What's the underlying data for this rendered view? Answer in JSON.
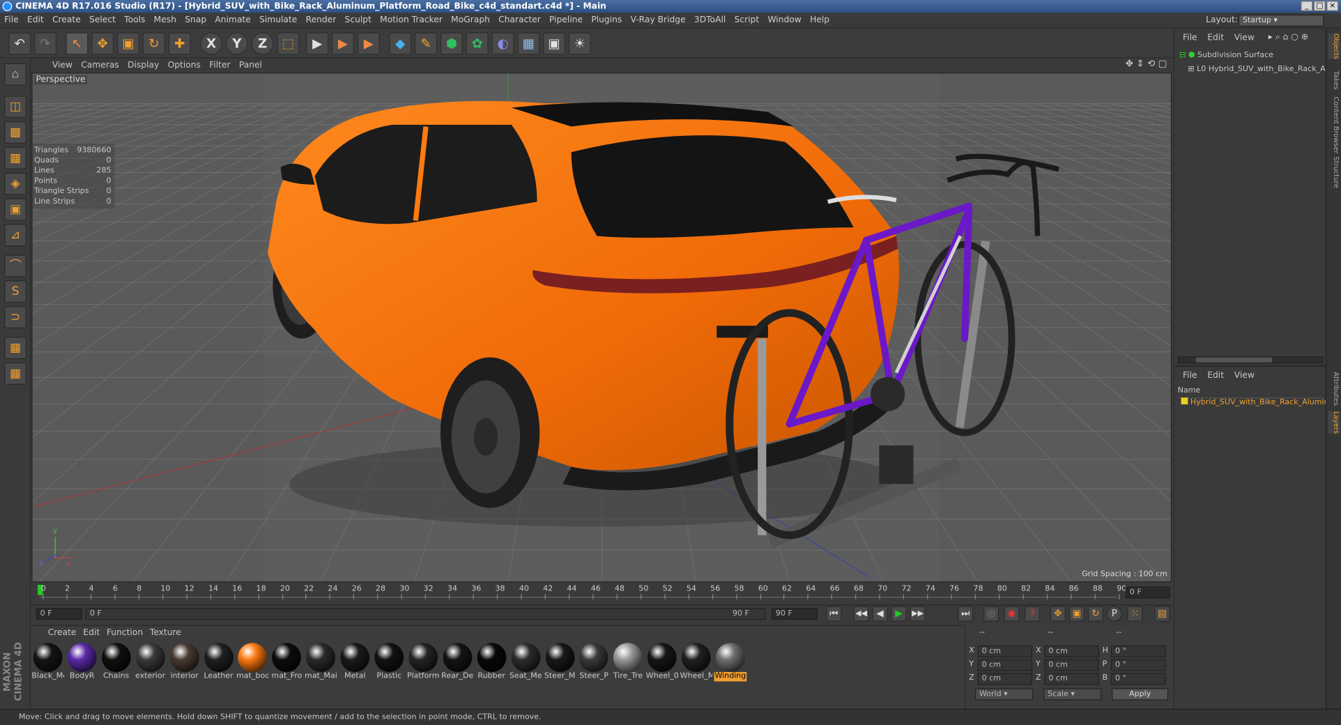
{
  "window": {
    "title": "CINEMA 4D R17.016 Studio (R17) - [Hybrid_SUV_with_Bike_Rack_Aluminum_Platform_Road_Bike_c4d_standart.c4d *] - Main",
    "min": "_",
    "max": "□",
    "close": "×"
  },
  "menu": [
    "File",
    "Edit",
    "Create",
    "Select",
    "Tools",
    "Mesh",
    "Snap",
    "Animate",
    "Simulate",
    "Render",
    "Sculpt",
    "Motion Tracker",
    "MoGraph",
    "Character",
    "Pipeline",
    "Plugins",
    "V-Ray Bridge",
    "3DToAll",
    "Script",
    "Window",
    "Help"
  ],
  "layout": {
    "label": "Layout:",
    "value": "Startup"
  },
  "toolbar": {
    "undo": "↶",
    "redo": "↷",
    "select": "↖",
    "move": "✥",
    "scale": "▣",
    "rotate": "↻",
    "add": "✚",
    "x": "X",
    "y": "Y",
    "z": "Z",
    "coord": "⬚",
    "render1": "▶",
    "render2": "▶",
    "render3": "▶",
    "cube": "◆",
    "pen": "✎",
    "subdiv": "⬢",
    "gen": "✿",
    "deform": "◐",
    "floor": "▦",
    "camera": "▣",
    "light": "☀"
  },
  "left_tools": [
    "⌂",
    "◫",
    "▩",
    "▦",
    "◈",
    "▣",
    "⊿",
    "⌒",
    "S",
    "⊃",
    "▦",
    "▦"
  ],
  "viewport": {
    "menu": [
      "View",
      "Cameras",
      "Display",
      "Options",
      "Filter",
      "Panel"
    ],
    "label": "Perspective",
    "stats": [
      {
        "k": "Triangles",
        "v": "9380660"
      },
      {
        "k": "Quads",
        "v": "0"
      },
      {
        "k": "Lines",
        "v": "285"
      },
      {
        "k": "Points",
        "v": "0"
      },
      {
        "k": "Triangle Strips",
        "v": "0"
      },
      {
        "k": "Line Strips",
        "v": "0"
      }
    ],
    "grid_spacing": "Grid Spacing : 100 cm",
    "axis": {
      "x": "x",
      "y": "y",
      "z": "z"
    }
  },
  "timeline": {
    "ticks": [
      "0",
      "2",
      "4",
      "6",
      "8",
      "10",
      "12",
      "14",
      "16",
      "18",
      "20",
      "22",
      "24",
      "26",
      "28",
      "30",
      "32",
      "34",
      "36",
      "38",
      "40",
      "42",
      "44",
      "46",
      "48",
      "50",
      "52",
      "54",
      "56",
      "58",
      "60",
      "62",
      "64",
      "66",
      "68",
      "70",
      "72",
      "74",
      "76",
      "78",
      "80",
      "82",
      "84",
      "86",
      "88",
      "90"
    ],
    "frame_field": "0 F"
  },
  "controls": {
    "start": "0 F",
    "range_start": "0 F",
    "range_end": "90 F",
    "end": "90 F",
    "buttons": [
      "⏮",
      "◀◀",
      "◀",
      "▶",
      "▶▶",
      "⏭"
    ]
  },
  "materials": {
    "menu": [
      "Create",
      "Edit",
      "Function",
      "Texture"
    ],
    "items": [
      {
        "name": "Black_Me",
        "color": "#151515"
      },
      {
        "name": "BodyR",
        "color": "#5a2aa8"
      },
      {
        "name": "Chains",
        "color": "#101010"
      },
      {
        "name": "exterior",
        "color": "#3a3a3a"
      },
      {
        "name": "interior",
        "color": "#4a3a32"
      },
      {
        "name": "Leather",
        "color": "#202020"
      },
      {
        "name": "mat_bod",
        "color": "#ff7a10"
      },
      {
        "name": "mat_Fro",
        "color": "#0c0c0c"
      },
      {
        "name": "mat_Mai",
        "color": "#2a2a2a"
      },
      {
        "name": "Metal",
        "color": "#1a1a1a"
      },
      {
        "name": "Plastic",
        "color": "#121212"
      },
      {
        "name": "Platform",
        "color": "#242424"
      },
      {
        "name": "Rear_De",
        "color": "#141414"
      },
      {
        "name": "Rubber",
        "color": "#080808"
      },
      {
        "name": "Seat_Me",
        "color": "#2c2c2c"
      },
      {
        "name": "Steer_M",
        "color": "#181818"
      },
      {
        "name": "Steer_P",
        "color": "#3a3a3a"
      },
      {
        "name": "Tire_Tre",
        "color": "#9a9a9a"
      },
      {
        "name": "Wheel_0",
        "color": "#161616"
      },
      {
        "name": "Wheel_M",
        "color": "#202020"
      },
      {
        "name": "Winding",
        "color": "#707070"
      }
    ],
    "selected": "Winding"
  },
  "attributes": {
    "header": [
      "--",
      "--",
      "--"
    ],
    "rows": [
      {
        "a": "X",
        "av": "0 cm",
        "b": "X",
        "bv": "0 cm",
        "c": "H",
        "cv": "0 °"
      },
      {
        "a": "Y",
        "av": "0 cm",
        "b": "Y",
        "bv": "0 cm",
        "c": "P",
        "cv": "0 °"
      },
      {
        "a": "Z",
        "av": "0 cm",
        "b": "Z",
        "bv": "0 cm",
        "c": "B",
        "cv": "0 °"
      }
    ],
    "world": "World",
    "scale": "Scale",
    "apply": "Apply"
  },
  "objects": {
    "menu": [
      "File",
      "Edit",
      "View"
    ],
    "items": [
      "Subdivision Surface",
      "Hybrid_SUV_with_Bike_Rack_Alumi"
    ]
  },
  "layers": {
    "menu": [
      "File",
      "Edit",
      "View"
    ],
    "header": "Name",
    "items": [
      "Hybrid_SUV_with_Bike_Rack_Alumin"
    ]
  },
  "vtabs": [
    "Objects",
    "Takes",
    "Content Browser",
    "Structure",
    "Attributes",
    "Layers"
  ],
  "status": "Move: Click and drag to move elements. Hold down SHIFT to quantize movement / add to the selection in point mode, CTRL to remove.",
  "brand": "MAXON CINEMA 4D"
}
